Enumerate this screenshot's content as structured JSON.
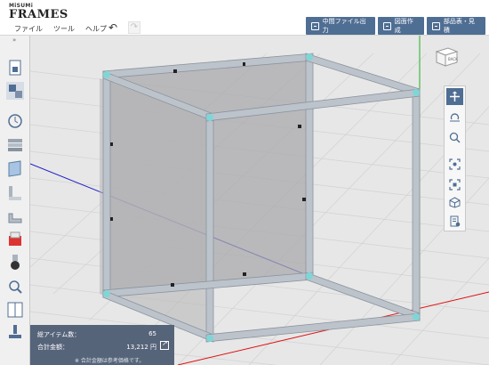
{
  "app": {
    "logo_top": "MiSUMi",
    "logo_main": "FRAMES"
  },
  "menu": [
    "ファイル",
    "ツール",
    "ヘルプ"
  ],
  "header_buttons": {
    "intermediate_output": "中間ファイル出力",
    "drawing": "図面作成",
    "parts_list": "部品表・見積"
  },
  "left_tools": [
    "new-document-icon",
    "parts-select-icon",
    "history-icon",
    "frame-profile-icon",
    "panel-icon",
    "bracket-icon",
    "corner-bracket-icon",
    "accessory-icon",
    "caster-icon",
    "search-icon",
    "layout-split-icon",
    "adjuster-foot-icon"
  ],
  "right_tools": [
    "move-icon",
    "rotate-icon",
    "zoom-icon",
    "fit-view-icon",
    "fit-selection-icon",
    "view-cube-icon",
    "parts-list-icon"
  ],
  "viewcube": {
    "label": "BACK"
  },
  "summary": {
    "item_count_label": "総アイテム数：",
    "item_count": "65",
    "total_label": "合計金額：",
    "total": "13,212 円",
    "note": "※ 合計金額は参考価格です。"
  },
  "colors": {
    "accent": "#4f6e93",
    "summary_bg": "#56647a",
    "axis_x": "#e01010",
    "axis_y": "#22b022",
    "axis_z": "#1a1ac8"
  }
}
